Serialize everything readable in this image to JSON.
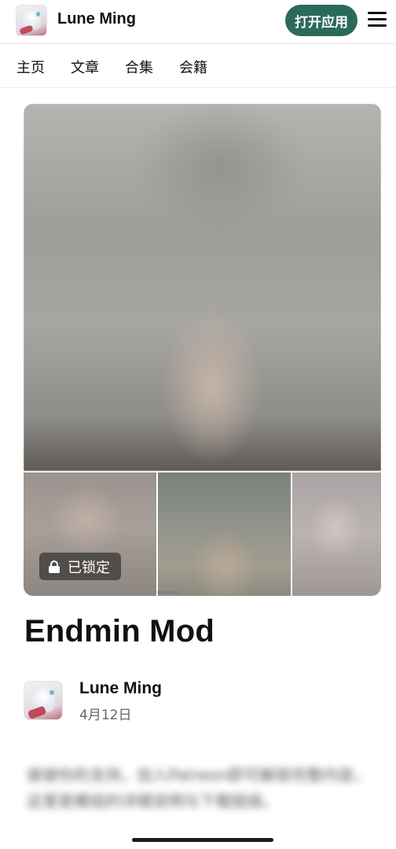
{
  "header": {
    "creator_name": "Lune Ming",
    "open_app_label": "打开应用"
  },
  "tabs": [
    {
      "label": "主页"
    },
    {
      "label": "文章"
    },
    {
      "label": "合集"
    },
    {
      "label": "会籍"
    }
  ],
  "gallery": {
    "locked_label": "已锁定"
  },
  "post": {
    "title": "Endmin Mod",
    "author": "Lune Ming",
    "date": "4月12日",
    "locked_body_preview": "谢谢你的支持，加入Patreon即可解锁完整内容，这里是模组的详细说明与下载链接。"
  },
  "icons": {
    "menu": "hamburger-menu-icon",
    "lock": "lock-icon"
  },
  "colors": {
    "open_app_bg": "#2b6a5a",
    "badge_bg": "#3c3a38"
  }
}
